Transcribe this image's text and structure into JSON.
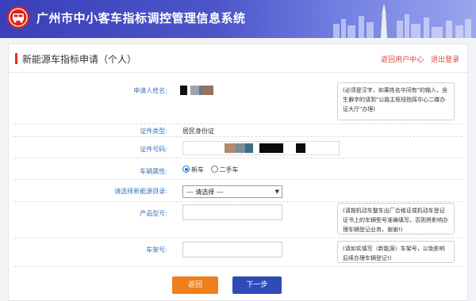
{
  "header": {
    "title": "广州市中小客车指标调控管理信息系统",
    "logo_icon": "bus-logo-icon",
    "colors": {
      "start": "#3b3fb8",
      "end": "#9aa6ee"
    }
  },
  "panel": {
    "title": "新能源车指标申请（个人）",
    "links": {
      "back_user_center": "返回用户中心",
      "logout": "退出登录"
    }
  },
  "form": {
    "applicant_name_label": "申请人姓名:",
    "name_note": "(必须是汉字，如果姓名中间有\"的输入，含生僻字的请到\"公路主枢纽指挥中心二楼办证大厅\"办理)",
    "id_type_label": "证件类型:",
    "id_type_value": "居民身份证",
    "id_number_label": "证件号码:",
    "vehicle_attr_label": "车辆属性:",
    "vehicle_options": [
      "新车",
      "二手车"
    ],
    "vehicle_selected": "新车",
    "catalog_label": "请选择新能源目录:",
    "catalog_value": "--- 请选择 ---",
    "model_label": "产品型号:",
    "model_value": "",
    "model_note": "(请按机动车整车出厂合格证或机动车登记证书上的车辆型号准确填写，否则将影响办理车辆登记业务，谢谢!)",
    "vin_label": "车架号:",
    "vin_value": "",
    "vin_note": "(请如实填写（新能源）车架号，以免影响后续办理车辆登记!)"
  },
  "buttons": {
    "back": "返回",
    "next": "下一步"
  }
}
